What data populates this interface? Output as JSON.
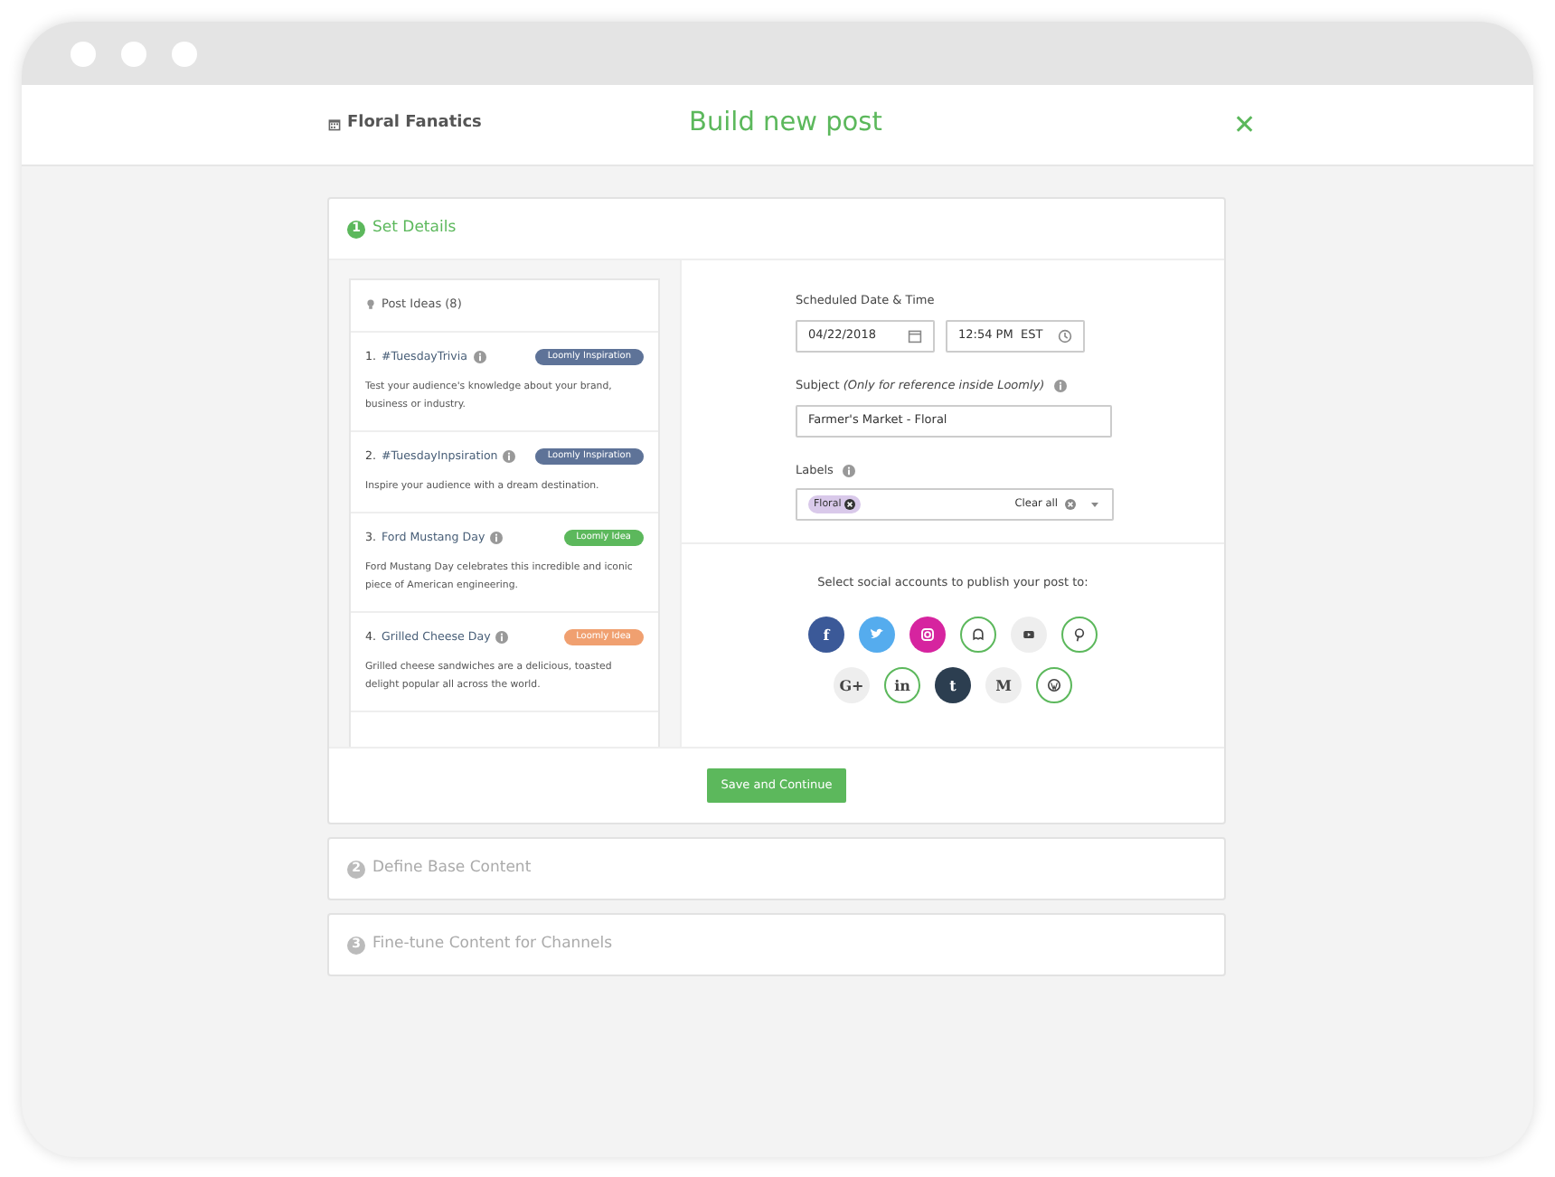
{
  "header": {
    "workspace": "Floral Fanatics",
    "title": "Build new post",
    "close": "✕"
  },
  "steps": [
    {
      "number": "1",
      "label": "Set Details",
      "expanded": true
    },
    {
      "number": "2",
      "label": "Define Base Content",
      "expanded": false
    },
    {
      "number": "3",
      "label": "Fine-tune Content for Channels",
      "expanded": false
    }
  ],
  "ideas": {
    "title": "Post Ideas (8)",
    "items": [
      {
        "number": "1.",
        "name": "#TuesdayTrivia",
        "badge": "Loomly Inspiration",
        "color": "#5e7398",
        "text": "Test your audience's knowledge about your brand, business or industry."
      },
      {
        "number": "2.",
        "name": "#TuesdayInpsiration",
        "badge": "Loomly Inspiration",
        "color": "#5e7398",
        "text": "Inspire your audience with a dream destination."
      },
      {
        "number": "3.",
        "name": "Ford Mustang Day",
        "badge": "Loomly Idea",
        "color": "#5cb85c",
        "text": "Ford Mustang Day celebrates this incredible and iconic piece of American engineering."
      },
      {
        "number": "4.",
        "name": "Grilled Cheese Day",
        "badge": "Loomly Idea",
        "color": "#f0a070",
        "text": "Grilled cheese sandwiches are a delicious, toasted delight popular all across the world."
      }
    ]
  },
  "form": {
    "schedule_label": "Scheduled Date & Time",
    "date": "04/22/2018",
    "time": "12:54 PM  EST",
    "subject_label": "Subject *(Only for reference inside Loomly)*",
    "subject": "Farmer's Market - Floral",
    "labels_label": "Labels",
    "tags": [
      {
        "text": "Floral"
      }
    ],
    "clear": "Clear all"
  },
  "accounts": {
    "prompt": "Select social accounts to publish your post to:",
    "rows": [
      [
        {
          "kind": "letter",
          "glyph": "f",
          "color": "#3b5998",
          "selected": true,
          "connected": true
        },
        {
          "kind": "bird",
          "color": "#55acee",
          "selected": true,
          "connected": true
        },
        {
          "kind": "camera",
          "color": "#d6249f",
          "selected": true,
          "connected": true
        },
        {
          "kind": "ghost",
          "selected": false,
          "connected": true
        },
        {
          "kind": "play",
          "selected": false,
          "connected": false
        },
        {
          "kind": "pin",
          "selected": false,
          "connected": true
        }
      ],
      [
        {
          "kind": "letter",
          "glyph": "G+",
          "selected": false,
          "connected": false
        },
        {
          "kind": "letter",
          "glyph": "in",
          "selected": false,
          "connected": true
        },
        {
          "kind": "letter",
          "glyph": "t",
          "color": "#2c3e50",
          "selected": true,
          "connected": true
        },
        {
          "kind": "letter",
          "glyph": "M",
          "selected": false,
          "connected": false
        },
        {
          "kind": "wp",
          "selected": false,
          "connected": true
        }
      ]
    ]
  },
  "save": "Save and Continue"
}
